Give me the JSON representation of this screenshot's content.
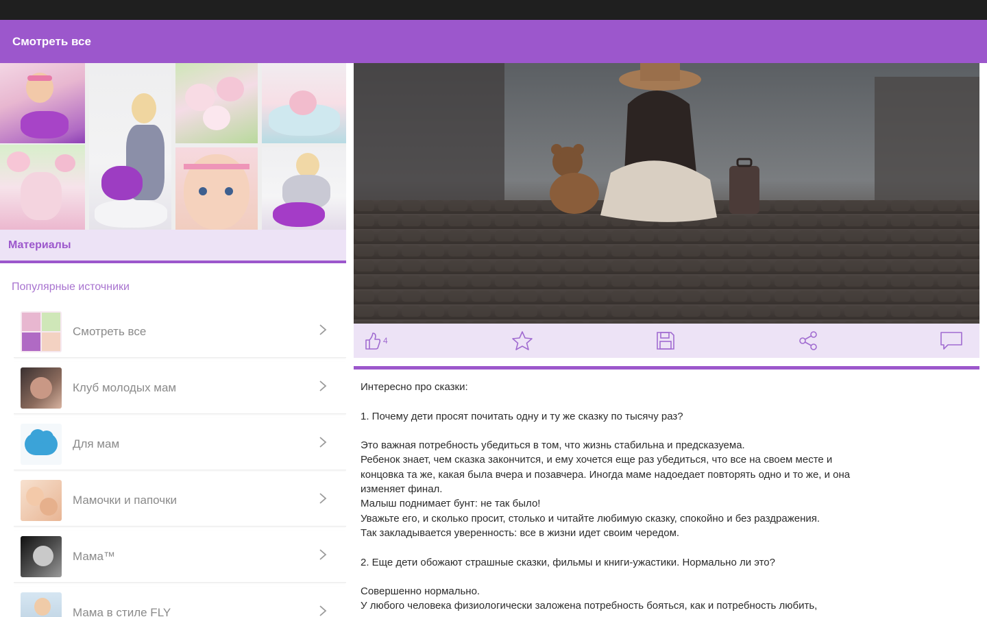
{
  "appbar": {
    "title": "Смотреть все"
  },
  "left": {
    "materials_title": "Материалы",
    "popular_title": "Популярные источники",
    "sources": [
      {
        "label": "Смотреть все"
      },
      {
        "label": "Клуб молодых мам"
      },
      {
        "label": "Для мам"
      },
      {
        "label": "Мамочки и папочки"
      },
      {
        "label": "Мама™"
      },
      {
        "label": "Мама в стиле FLY"
      }
    ]
  },
  "post": {
    "like_count": "4",
    "text": "Интересно про сказки:\n\n1. Почему дети просят почитать одну и ту же сказку по тысячу раз?\n\nЭто важная потребность убедиться в том, что жизнь стабильна и предсказуема.\nРебенок знает, чем сказка закончится, и ему хочется еще раз убедиться, что все на своем месте и\nконцовка та же, какая была вчера и позавчера. Иногда маме надоедает повторять одно и то же, и она\nизменяет финал.\nМалыш поднимает бунт: не так было!\nУважьте его, и сколько просит, столько и читайте любимую сказку, спокойно и без раздражения.\nТак закладывается уверенность: все в жизни идет своим чередом.\n\n2. Еще дети обожают страшные сказки, фильмы и книги-ужастики. Нормально ли это?\n\nСовершенно нормально.\nУ любого человека физиологически заложена потребность бояться, как и потребность любить,"
  }
}
